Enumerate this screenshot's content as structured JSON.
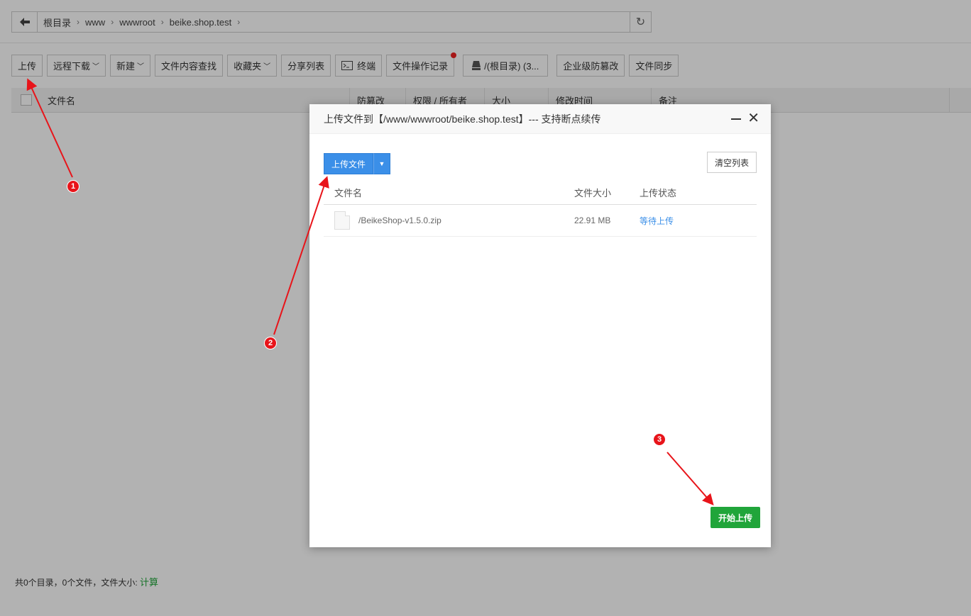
{
  "address_bar": {
    "breadcrumbs": [
      "根目录",
      "www",
      "wwwroot",
      "beike.shop.test"
    ]
  },
  "toolbar": {
    "upload": "上传",
    "remote_download": "远程下载",
    "new": "新建",
    "content_search": "文件内容查找",
    "favorites": "收藏夹",
    "share_list": "分享列表",
    "terminal": "终端",
    "op_log": "文件操作记录",
    "disk": "/(根目录) (3...",
    "tamper_proof": "企业级防篡改",
    "file_sync": "文件同步"
  },
  "table": {
    "columns": [
      "文件名",
      "防篡改",
      "权限 / 所有者",
      "大小",
      "修改时间",
      "备注"
    ]
  },
  "footer": {
    "stat": "共0个目录，0个文件，文件大小:",
    "calc": "计算"
  },
  "dialog": {
    "title": "上传文件到【/www/wwwroot/beike.shop.test】--- 支持断点续传",
    "upload_file": "上传文件",
    "clear_list": "清空列表",
    "columns": {
      "name": "文件名",
      "size": "文件大小",
      "state": "上传状态"
    },
    "files": [
      {
        "name": "/BeikeShop-v1.5.0.zip",
        "size": "22.91 MB",
        "state": "等待上传"
      }
    ],
    "start_upload": "开始上传"
  },
  "annotations": [
    "1",
    "2",
    "3"
  ],
  "colors": {
    "primary": "#3b8fe8",
    "success": "#20a53a",
    "marker": "#e8141a"
  }
}
